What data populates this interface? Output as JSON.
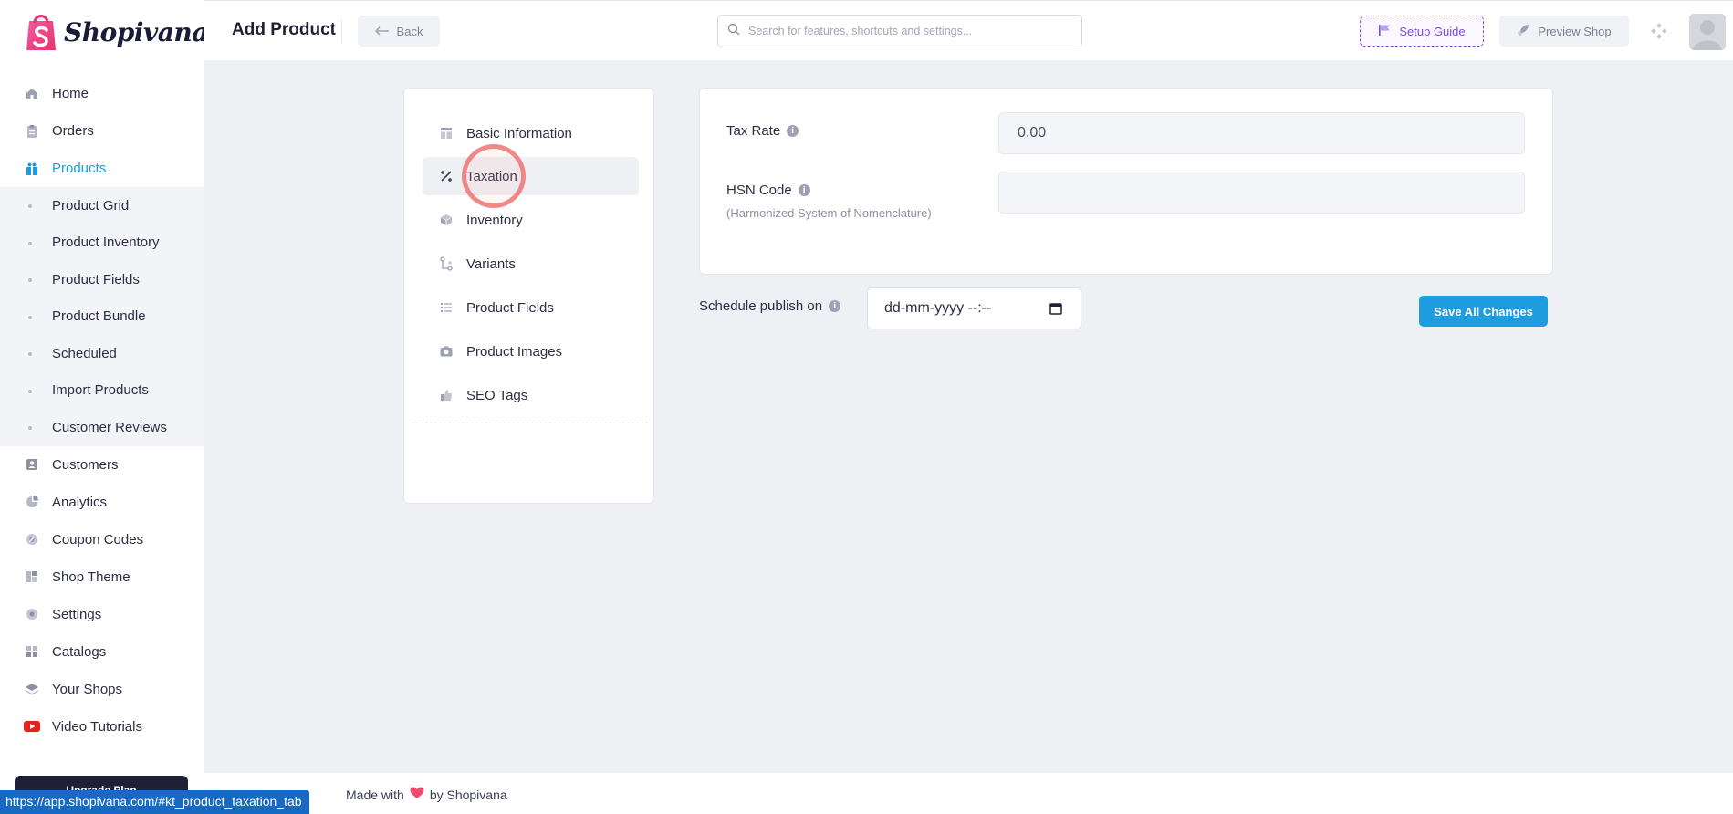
{
  "brand": {
    "name": "Shopivana",
    "accent": "#1e9ce0",
    "purple": "#7e4cdb"
  },
  "header": {
    "title": "Add Product",
    "back_label": "Back",
    "search_placeholder": "Search for features, shortcuts and settings...",
    "setup_label": "Setup Guide",
    "preview_label": "Preview Shop"
  },
  "sidebar": {
    "items": [
      {
        "label": "Home",
        "icon": "home-icon"
      },
      {
        "label": "Orders",
        "icon": "clipboard-icon"
      },
      {
        "label": "Products",
        "icon": "gift-icon",
        "active": true
      }
    ],
    "product_submenu": [
      "Product Grid",
      "Product Inventory",
      "Product Fields",
      "Product Bundle",
      "Scheduled",
      "Import Products",
      "Customer Reviews"
    ],
    "items_after": [
      {
        "label": "Customers",
        "icon": "user-card-icon"
      },
      {
        "label": "Analytics",
        "icon": "pie-chart-icon"
      },
      {
        "label": "Coupon Codes",
        "icon": "coupon-icon"
      },
      {
        "label": "Shop Theme",
        "icon": "layout-icon"
      },
      {
        "label": "Settings",
        "icon": "gear-icon"
      },
      {
        "label": "Catalogs",
        "icon": "catalog-icon"
      },
      {
        "label": "Your Shops",
        "icon": "layers-icon"
      },
      {
        "label": "Video Tutorials",
        "icon": "youtube-icon"
      }
    ],
    "upgrade_label": "Upgrade Plan"
  },
  "tabs": [
    {
      "label": "Basic Information",
      "icon": "table-icon"
    },
    {
      "label": "Taxation",
      "icon": "percent-icon",
      "active": true
    },
    {
      "label": "Inventory",
      "icon": "box-icon"
    },
    {
      "label": "Variants",
      "icon": "variants-icon"
    },
    {
      "label": "Product Fields",
      "icon": "list-icon"
    },
    {
      "label": "Product Images",
      "icon": "camera-icon"
    },
    {
      "label": "SEO Tags",
      "icon": "thumbs-up-icon"
    }
  ],
  "form": {
    "tax_rate_label": "Tax Rate",
    "tax_rate_value": "0.00",
    "hsn_label": "HSN Code",
    "hsn_hint": "(Harmonized System of Nomenclature)",
    "hsn_value": "",
    "schedule_label": "Schedule publish on",
    "schedule_value": "dd-mm-yyyy --:--",
    "save_label": "Save All Changes"
  },
  "footer": {
    "made_with": "Made with",
    "by": "by Shopivana"
  },
  "status_url": "https://app.shopivana.com/#kt_product_taxation_tab"
}
